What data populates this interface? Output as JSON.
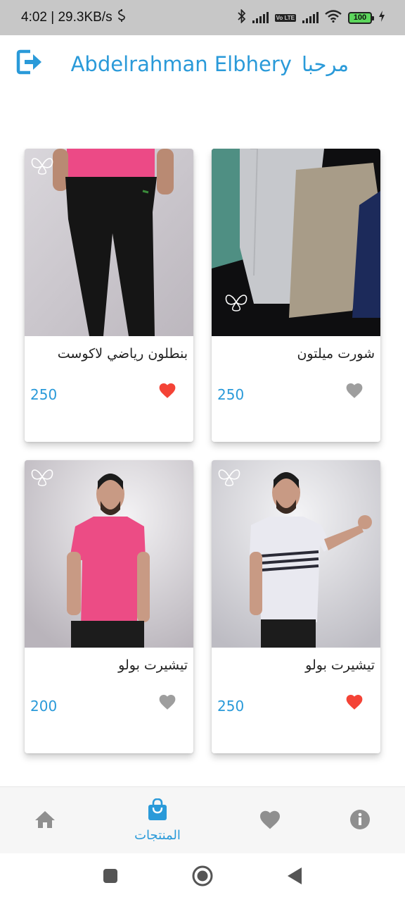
{
  "status_bar": {
    "time_speed": "4:02 | 29.3KB/s",
    "volte_label": "Vo LTE",
    "battery_level": "100"
  },
  "header": {
    "greeting": "مرحبا",
    "user_name": "Abdelrahman Elbhery",
    "logout_icon": "logout-icon"
  },
  "products": [
    {
      "name": "بنطلون رياضي لاكوست",
      "price": "250",
      "favorite": true
    },
    {
      "name": "شورت ميلتون",
      "price": "250",
      "favorite": false
    },
    {
      "name": "تيشيرت بولو",
      "price": "200",
      "favorite": false
    },
    {
      "name": "تيشيرت بولو",
      "price": "250",
      "favorite": true
    }
  ],
  "bottom_nav": {
    "items": [
      {
        "icon": "home-icon",
        "label": ""
      },
      {
        "icon": "shopping-bag-icon",
        "label": "المنتجات",
        "active": true
      },
      {
        "icon": "heart-icon",
        "label": ""
      },
      {
        "icon": "info-icon",
        "label": ""
      }
    ]
  },
  "colors": {
    "accent": "#2a9ad9",
    "favorite_active": "#f44336",
    "favorite_inactive": "#9e9e9e"
  }
}
